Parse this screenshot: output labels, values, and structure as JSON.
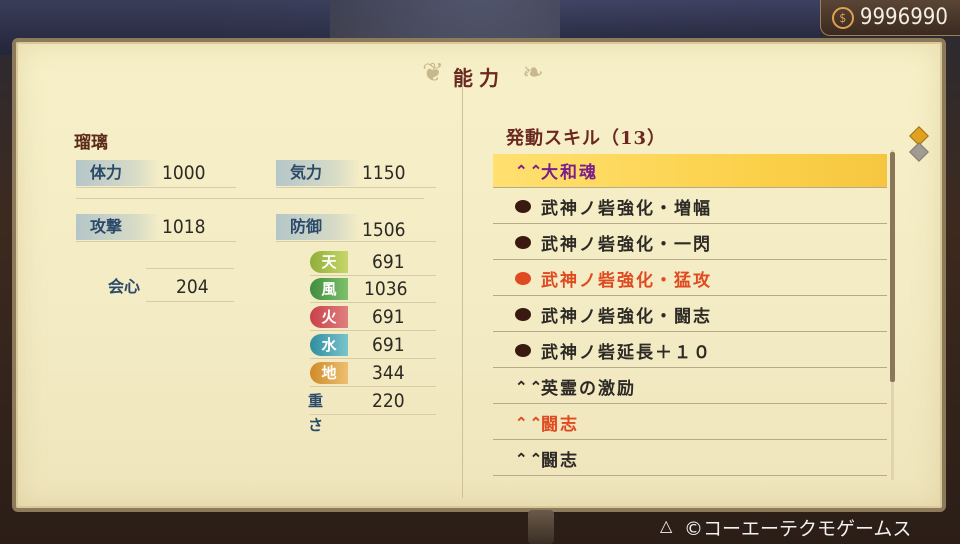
{
  "money": {
    "symbol": "$",
    "amount": "9996990"
  },
  "panel_title": "能力",
  "character": {
    "name": "瑠璃"
  },
  "stats": {
    "hp": {
      "label": "体力",
      "value": "1000"
    },
    "ki": {
      "label": "気力",
      "value": "1150"
    },
    "attack": {
      "label": "攻撃",
      "value": "1018"
    },
    "defense": {
      "label": "防御",
      "value": "1506"
    },
    "crit": {
      "label": "会心",
      "value": "204"
    },
    "weight": {
      "label": "重さ",
      "value": "220"
    }
  },
  "elements": [
    {
      "label": "天",
      "value": "691",
      "color": "#8fae3a"
    },
    {
      "label": "風",
      "value": "1036",
      "color": "#4a9a4a"
    },
    {
      "label": "火",
      "value": "691",
      "color": "#c8404a"
    },
    {
      "label": "水",
      "value": "691",
      "color": "#3a9aaa"
    },
    {
      "label": "地",
      "value": "344",
      "color": "#d89a3a"
    }
  ],
  "skills": {
    "title": "発動スキル（13）",
    "items": [
      {
        "label": "大和魂",
        "icon": "chevron-up-icon",
        "color": "#7a1e8a"
      },
      {
        "label": "武神ノ砦強化・増幅",
        "icon": "orb-icon",
        "color": "#2d2a26"
      },
      {
        "label": "武神ノ砦強化・一閃",
        "icon": "orb-icon",
        "color": "#2d2a26"
      },
      {
        "label": "武神ノ砦強化・猛攻",
        "icon": "orb-icon",
        "color": "#e04a20"
      },
      {
        "label": "武神ノ砦強化・闘志",
        "icon": "orb-icon",
        "color": "#2d2a26"
      },
      {
        "label": "武神ノ砦延長＋１０",
        "icon": "orb-icon",
        "color": "#2d2a26"
      },
      {
        "label": "英霊の激励",
        "icon": "chevron-up-icon",
        "color": "#2d2a26"
      },
      {
        "label": "闘志",
        "icon": "chevron-up-icon",
        "color": "#e04a20"
      },
      {
        "label": "闘志",
        "icon": "chevron-up-icon",
        "color": "#2d2a26"
      }
    ]
  },
  "footer": {
    "copyright": "©コーエーテクモゲームス"
  }
}
